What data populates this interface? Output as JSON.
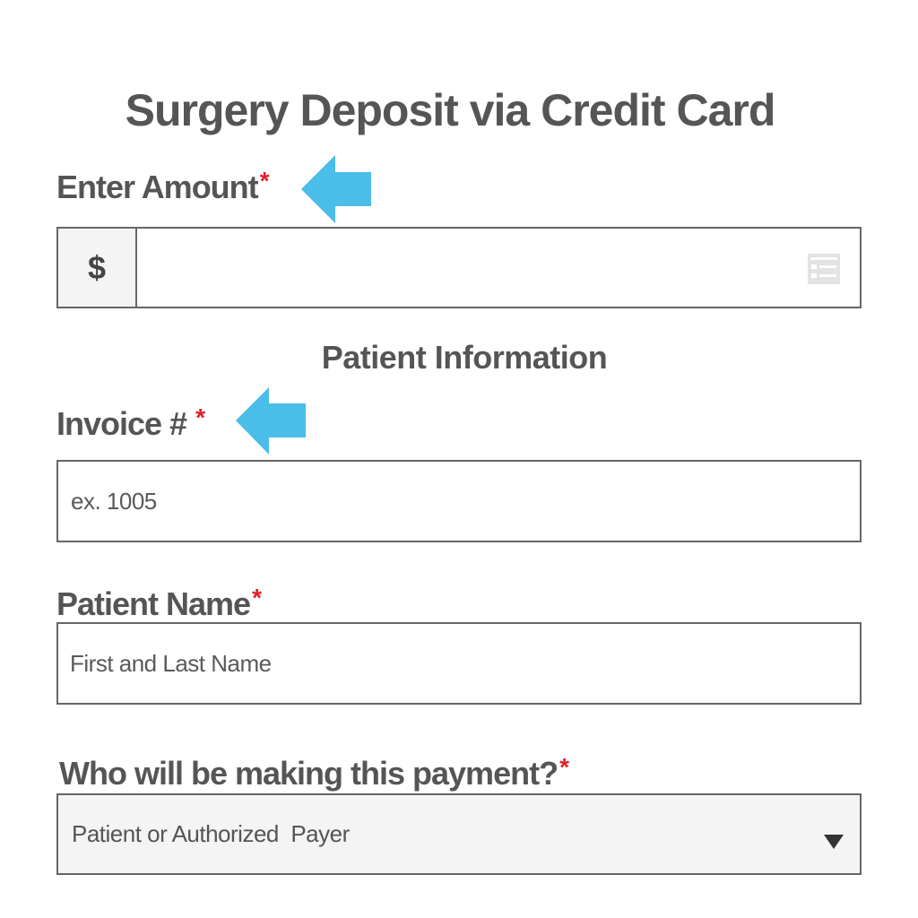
{
  "page": {
    "title": "Surgery Deposit via Credit Card"
  },
  "colors": {
    "text": "#555555",
    "required_asterisk": "#e0202a",
    "arrow": "#4bbde9",
    "border": "#666666",
    "select_background": "#f4f4f4"
  },
  "amount": {
    "label": "Enter Amount",
    "required_mark": "*",
    "currency_symbol": "$",
    "value": "",
    "icon": "autofill-list-icon",
    "arrow_icon": "arrow-left-icon"
  },
  "patient_section": {
    "heading": "Patient Information"
  },
  "invoice": {
    "label": "Invoice #",
    "required_mark": "*",
    "placeholder": "ex. 1005",
    "arrow_icon": "arrow-left-icon"
  },
  "patient_name": {
    "label": "Patient Name",
    "required_mark": "*",
    "placeholder": "First and Last Name"
  },
  "payer": {
    "label": "Who will be making this payment?",
    "required_mark": "*",
    "selected_value": "Patient or Authorized  Payer",
    "icon": "triangle-down-icon"
  }
}
